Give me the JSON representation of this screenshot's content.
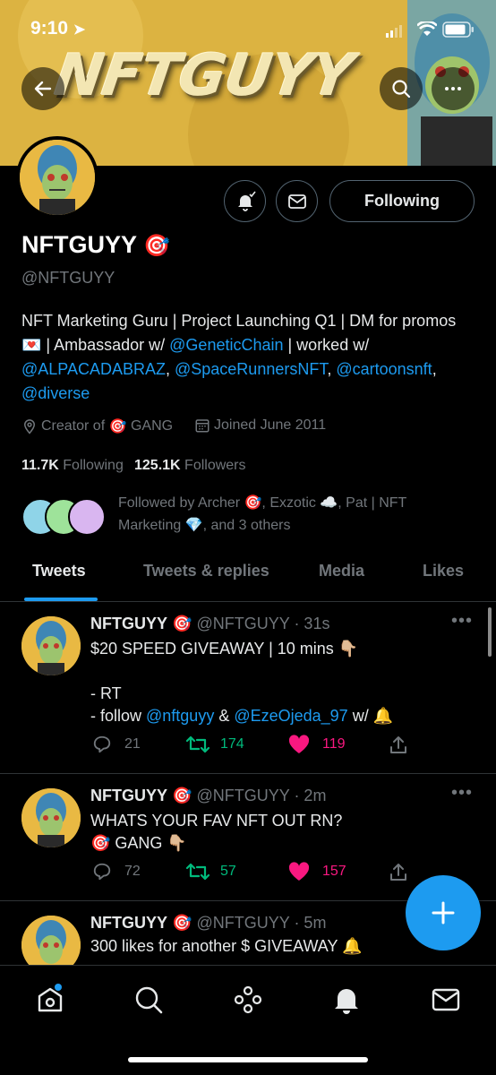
{
  "status_bar": {
    "time": "9:10"
  },
  "profile": {
    "banner_text": "NFTGUYY",
    "display_name": "NFTGUYY",
    "name_emoji": "🎯",
    "handle": "@NFTGUYY",
    "following_button": "Following",
    "bio": {
      "p1": "NFT Marketing Guru | Project Launching Q1 | DM for promos ",
      "e1": "💌",
      "p2": " | Ambassador w/ ",
      "m1": "@GeneticChain",
      "p3": " | worked w/ ",
      "m2": "@ALPACADABRAZ",
      "p4": ", ",
      "m3": "@SpaceRunnersNFT",
      "p5": ", ",
      "m4": "@cartoonsnft",
      "p6": ", ",
      "m5": "@diverse"
    },
    "location_prefix": "Creator of",
    "location_emoji": "🎯",
    "location_suffix": "GANG",
    "joined": "Joined June 2011",
    "following_count": "11.7K",
    "following_label": "Following",
    "followers_count": "125.1K",
    "followers_label": "Followers",
    "followed_by": "Followed by Archer 🎯, Exzotic ☁️, Pat | NFT Marketing 💎, and 3 others"
  },
  "tabs": [
    "Tweets",
    "Tweets & replies",
    "Media",
    "Likes"
  ],
  "tweets": [
    {
      "name": "NFTGUYY",
      "emoji": "🎯",
      "handle": "@NFTGUYY",
      "time": "· 31s",
      "line1": "$20 SPEED GIVEAWAY | 10 mins 👇🏼",
      "line2": "- RT",
      "line3_pre": "- follow ",
      "line3_m1": "@nftguyy",
      "line3_mid": " & ",
      "line3_m2": "@EzeOjeda_97",
      "line3_post": " w/ 🔔",
      "replies": "21",
      "retweets": "174",
      "likes": "119"
    },
    {
      "name": "NFTGUYY",
      "emoji": "🎯",
      "handle": "@NFTGUYY",
      "time": "· 2m",
      "line1": "WHATS YOUR FAV NFT OUT RN?",
      "line2": "🎯 GANG 👇🏼",
      "replies": "72",
      "retweets": "57",
      "likes": "157"
    },
    {
      "name": "NFTGUYY",
      "emoji": "🎯",
      "handle": "@NFTGUYY",
      "time": "· 5m",
      "line1": "300 likes for another $ GIVEAWAY 🔔"
    }
  ],
  "colors": {
    "accent": "#1d9bf0",
    "retweet": "#00ba7c",
    "like": "#f91880",
    "muted": "#71767b"
  },
  "icons": [
    "back-arrow-icon",
    "search-icon",
    "more-icon",
    "notification-bell-icon",
    "mail-icon",
    "location-icon",
    "calendar-icon",
    "reply-icon",
    "retweet-icon",
    "heart-icon",
    "share-icon",
    "plus-icon",
    "home-icon",
    "explore-icon",
    "spaces-icon",
    "notifications-icon",
    "messages-icon"
  ]
}
